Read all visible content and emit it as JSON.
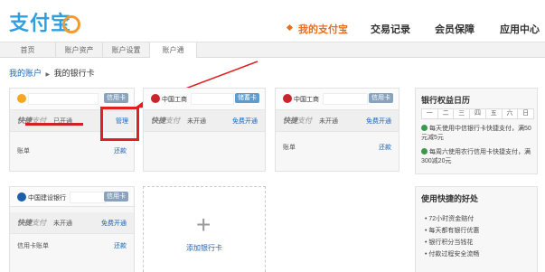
{
  "header": {
    "logo": "支付宝",
    "nav": [
      {
        "label": "我的支付宝",
        "active": true
      },
      {
        "label": "交易记录",
        "active": false
      },
      {
        "label": "会员保障",
        "active": false
      },
      {
        "label": "应用中心",
        "active": false
      }
    ]
  },
  "subnav": [
    {
      "label": "首页",
      "active": false
    },
    {
      "label": "账户资产",
      "active": false
    },
    {
      "label": "账户设置",
      "active": false
    },
    {
      "label": "账户通",
      "active": true
    }
  ],
  "breadcrumb": {
    "root": "我的账户",
    "separator": "▶",
    "current": "我的银行卡"
  },
  "cards": [
    {
      "bank": "",
      "type": "信用卡",
      "kj_main": "快捷",
      "kj_sub": "支付",
      "status": "已开通",
      "action": "管理",
      "bill_label": "账单",
      "bill_action": "还款"
    },
    {
      "bank": "中国工商",
      "type": "储蓄卡",
      "kj_main": "快捷",
      "kj_sub": "支付",
      "status": "未开通",
      "action": "免费开通",
      "bill_label": "",
      "bill_action": ""
    },
    {
      "bank": "中国工商",
      "type": "信用卡",
      "kj_main": "快捷",
      "kj_sub": "支付",
      "status": "未开通",
      "action": "免费开通",
      "bill_label": "账单",
      "bill_action": "还款"
    },
    {
      "bank": "中国建设银行",
      "type": "信用卡",
      "kj_main": "快捷",
      "kj_sub": "支付",
      "status": "未开通",
      "action": "免费开通",
      "bill_label": "信用卡账单",
      "bill_action": "还款"
    }
  ],
  "add_card": {
    "label": "添加银行卡"
  },
  "sidebar": {
    "calendar_title": "银行权益日历",
    "weekdays": [
      "一",
      "二",
      "三",
      "四",
      "五",
      "六",
      "日"
    ],
    "promos": [
      "每天使用中信银行卡快捷支付，满50元减5元",
      "每周六使用农行信用卡快捷支付，满300减20元"
    ],
    "benefits_title": "使用快捷的好处",
    "benefits": [
      "72小时资金赔付",
      "每天都有银行优惠",
      "银行积分当钱花",
      "付款过程安全流畅"
    ]
  }
}
